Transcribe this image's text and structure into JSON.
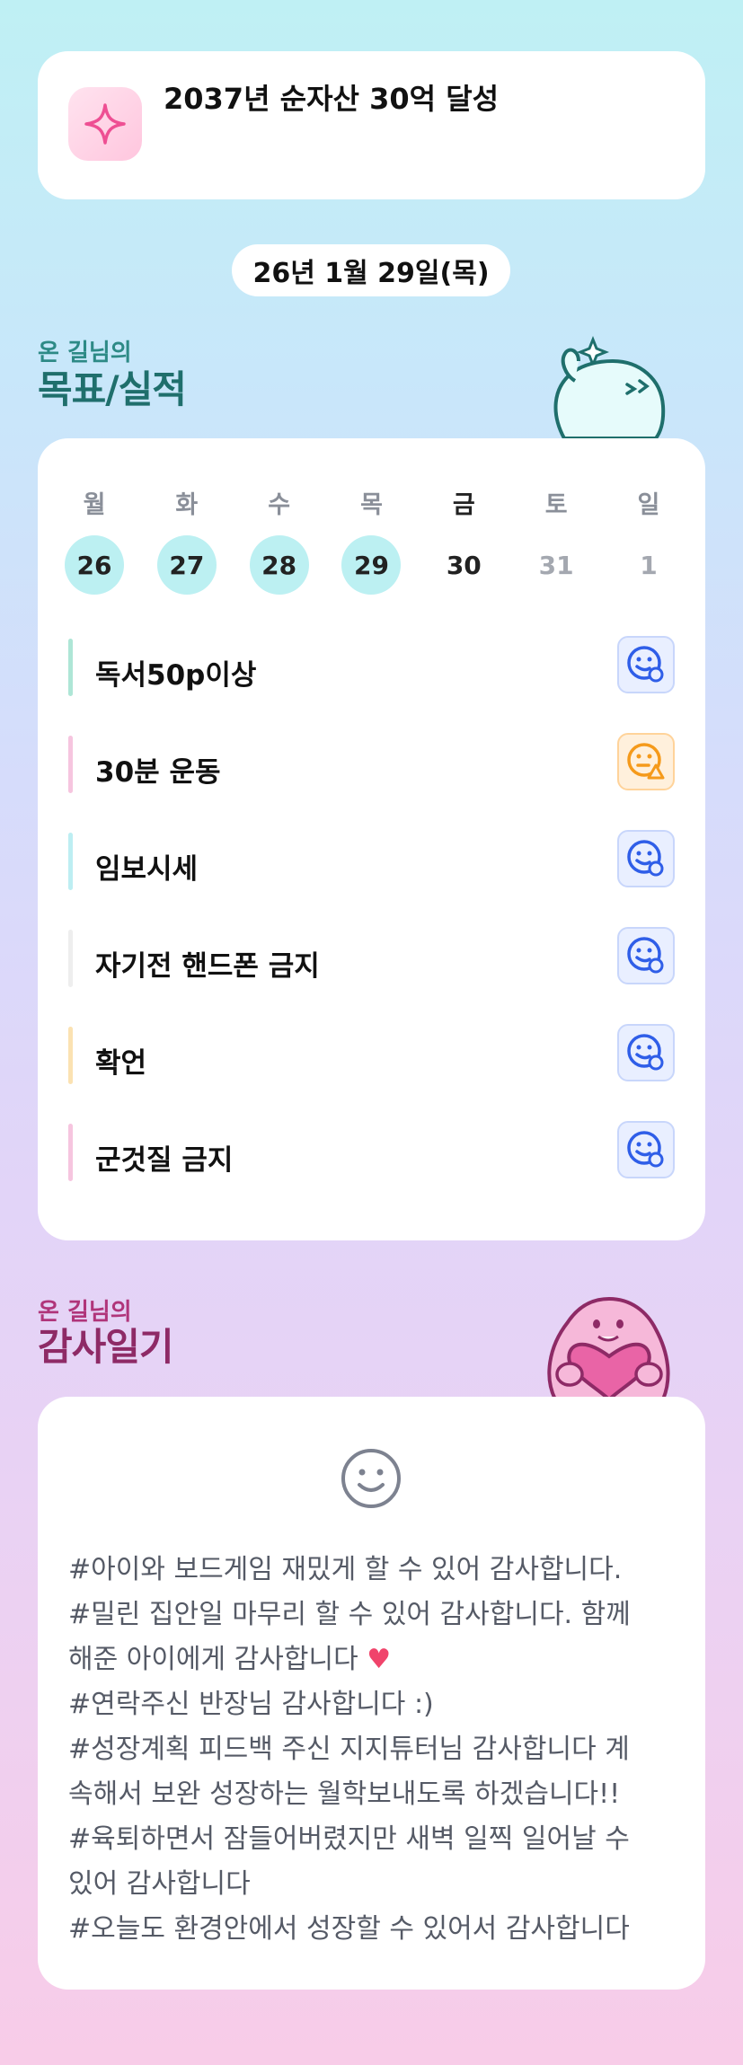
{
  "goal": {
    "icon": "sparkle-icon",
    "text": "2037년 순자산 30억 달성"
  },
  "date_label": "26년 1월 29일(목)",
  "goals_section": {
    "subtitle": "온 길님의",
    "title": "목표/실적",
    "subtitle_color": "#2d8a86",
    "title_color": "#1f6f6c"
  },
  "week": {
    "days": [
      {
        "name": "월",
        "date": "26",
        "state": "done"
      },
      {
        "name": "화",
        "date": "27",
        "state": "done"
      },
      {
        "name": "수",
        "date": "28",
        "state": "done"
      },
      {
        "name": "목",
        "date": "29",
        "state": "done"
      },
      {
        "name": "금",
        "date": "30",
        "state": "today"
      },
      {
        "name": "토",
        "date": "31",
        "state": "future"
      },
      {
        "name": "일",
        "date": "1",
        "state": "future"
      }
    ]
  },
  "tasks": [
    {
      "label": "독서50p이상",
      "bar_color": "#aee6d6",
      "status": "good",
      "icon": "smile-check-icon"
    },
    {
      "label": "30분 운동",
      "bar_color": "#f6c5df",
      "status": "warn",
      "icon": "smile-warning-icon"
    },
    {
      "label": "임보시세",
      "bar_color": "#bdeef2",
      "status": "good",
      "icon": "smile-check-icon"
    },
    {
      "label": "자기전 핸드폰 금지",
      "bar_color": "#eeeeee",
      "status": "good",
      "icon": "smile-check-icon"
    },
    {
      "label": "확언",
      "bar_color": "#fbe2b2",
      "status": "good",
      "icon": "smile-check-icon"
    },
    {
      "label": "군것질 금지",
      "bar_color": "#f6c5df",
      "status": "good",
      "icon": "smile-check-icon"
    }
  ],
  "gratitude_section": {
    "subtitle": "온 길님의",
    "title": "감사일기",
    "subtitle_color": "#b0357a",
    "title_color": "#8e2a66"
  },
  "gratitude": {
    "icon": "smile-face-icon",
    "lines": [
      "#아이와 보드게임 재밌게 할 수 있어 감사합니다.",
      "#밀린 집안일 마무리 할 수 있어 감사합니다. 함께",
      "해준 아이에게 감사합니다",
      "#연락주신 반장님 감사합니다 :)",
      "#성장계획 피드백 주신 지지튜터님 감사합니다 계",
      "속해서 보완 성장하는 월학보내도록 하겠습니다!!",
      "#육퇴하면서 잠들어버렸지만 새벽 일찍 일어날 수",
      "있어 감사합니다",
      "#오늘도 환경안에서 성장할 수 있어서 감사합니다"
    ],
    "heart_after_line": 2,
    "heart_icon": "heart-icon"
  }
}
